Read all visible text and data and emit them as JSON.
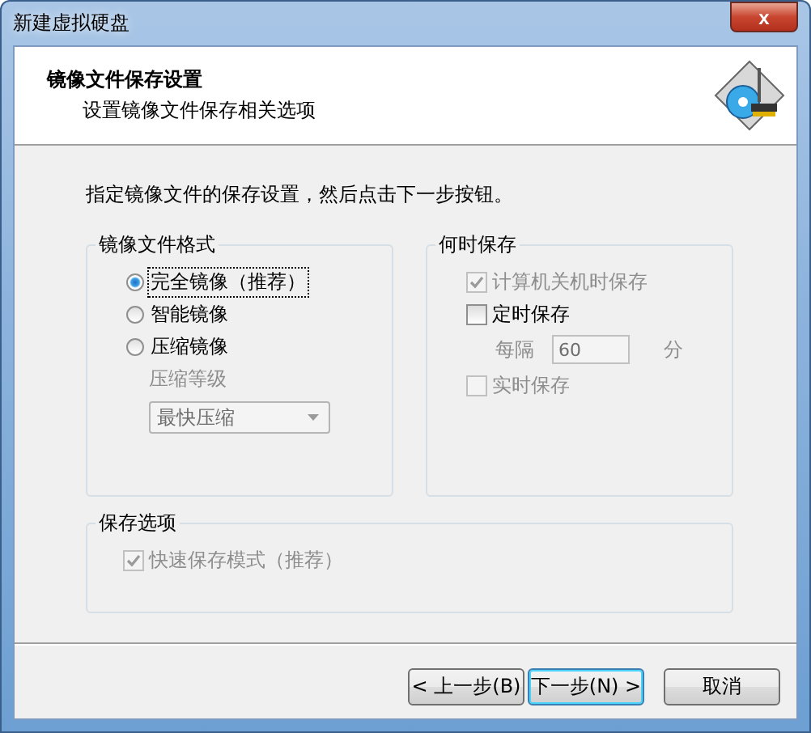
{
  "window": {
    "title": "新建虚拟硬盘",
    "close": "x"
  },
  "header": {
    "title": "镜像文件保存设置",
    "subtitle": "设置镜像文件保存相关选项"
  },
  "instruction": "指定镜像文件的保存设置，然后点击下一步按钮。",
  "image_format": {
    "title": "镜像文件格式",
    "options": [
      {
        "label": "完全镜像（推荐）",
        "selected": true,
        "focused": true
      },
      {
        "label": "智能镜像",
        "selected": false,
        "focused": false
      },
      {
        "label": "压缩镜像",
        "selected": false,
        "focused": false
      }
    ],
    "compression": {
      "label": "压缩等级",
      "value": "最快压缩",
      "disabled": true
    }
  },
  "when_to_save": {
    "title": "何时保存",
    "items": [
      {
        "kind": "checkbox",
        "label": "计算机关机时保存",
        "checked": true,
        "disabled": true
      },
      {
        "kind": "checkbox",
        "label": "定时保存",
        "checked": false,
        "disabled": false
      },
      {
        "kind": "interval",
        "label": "每隔",
        "value": "60",
        "unit": "分",
        "disabled": true
      },
      {
        "kind": "checkbox",
        "label": "实时保存",
        "checked": false,
        "disabled": true
      }
    ]
  },
  "save_options": {
    "title": "保存选项",
    "items": [
      {
        "label": "快速保存模式（推荐）",
        "checked": true,
        "disabled": true
      }
    ]
  },
  "buttons": [
    {
      "label": "< 上一步(B)",
      "default": false
    },
    {
      "label": "下一步(N) >",
      "default": true
    },
    {
      "label": "取消",
      "default": false
    }
  ]
}
